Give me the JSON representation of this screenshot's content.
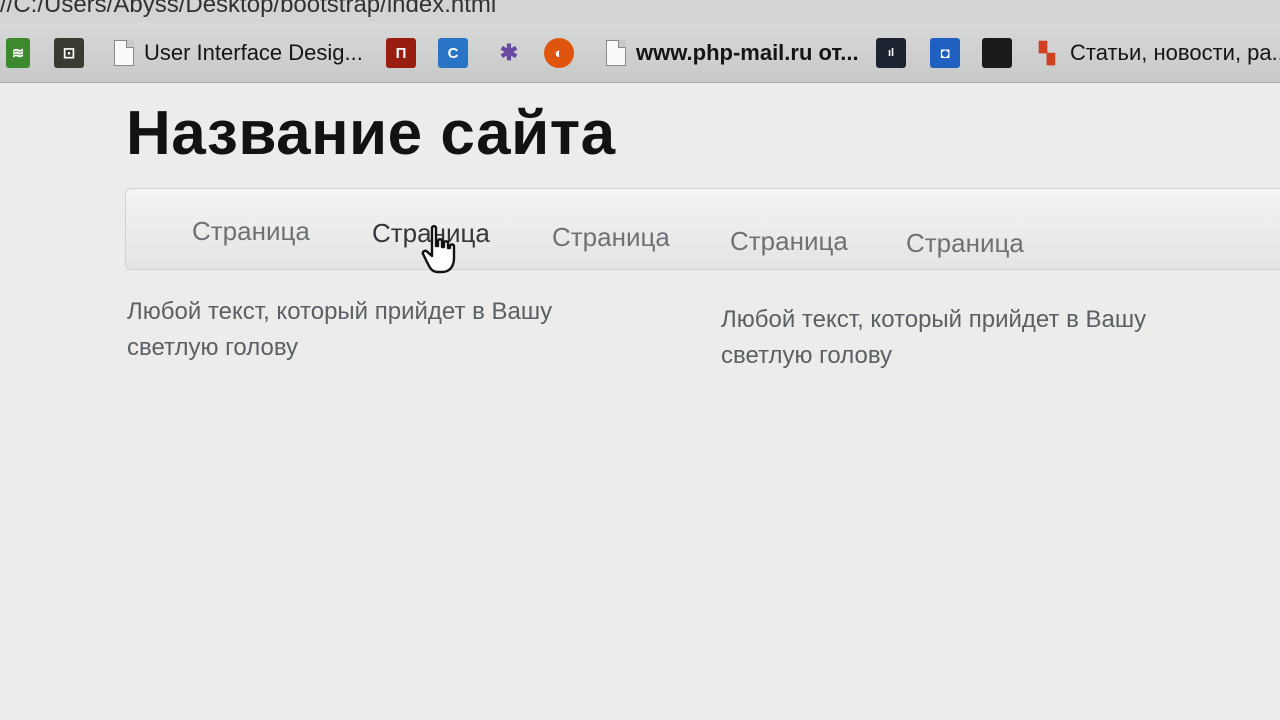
{
  "browser": {
    "address": "//C:/Users/Abyss/Desktop/bootstrap/index.html",
    "bookmarks": [
      {
        "icon": "evernote-icon",
        "color": "#3d8a2e",
        "label": ""
      },
      {
        "icon": "app-icon",
        "color": "#3a3a30",
        "label": ""
      },
      {
        "icon": "page-icon",
        "color": "",
        "label": "User Interface Desig..."
      },
      {
        "icon": "bookmark-icon-red",
        "color": "#9a1e10",
        "label": ""
      },
      {
        "icon": "bookmark-icon-blue",
        "color": "#2a74c6",
        "label": ""
      },
      {
        "icon": "bookmark-icon-multicolor",
        "color": "#6a4aa0",
        "label": ""
      },
      {
        "icon": "bookmark-icon-orange",
        "color": "#e0550e",
        "label": ""
      },
      {
        "icon": "page-icon",
        "color": "",
        "label": "www.php-mail.ru от..."
      },
      {
        "icon": "bookmark-icon-dark",
        "color": "#1c2330",
        "label": ""
      },
      {
        "icon": "bookmark-icon-blue-2",
        "color": "#2060c0",
        "label": ""
      },
      {
        "icon": "bookmark-icon-black",
        "color": "#1a1a1a",
        "label": ""
      },
      {
        "icon": "bookmark-icon-colorful",
        "color": "#d04020",
        "label": "Статьи, новости, ра..."
      }
    ]
  },
  "page": {
    "title": "Название сайта",
    "nav": [
      "Страница",
      "Страница",
      "Страница",
      "Страница",
      "Страница"
    ],
    "columns": [
      "Любой текст, который прийдет в Вашу светлую голову",
      "Любой текст, который прийдет в Вашу светлую голову"
    ]
  }
}
